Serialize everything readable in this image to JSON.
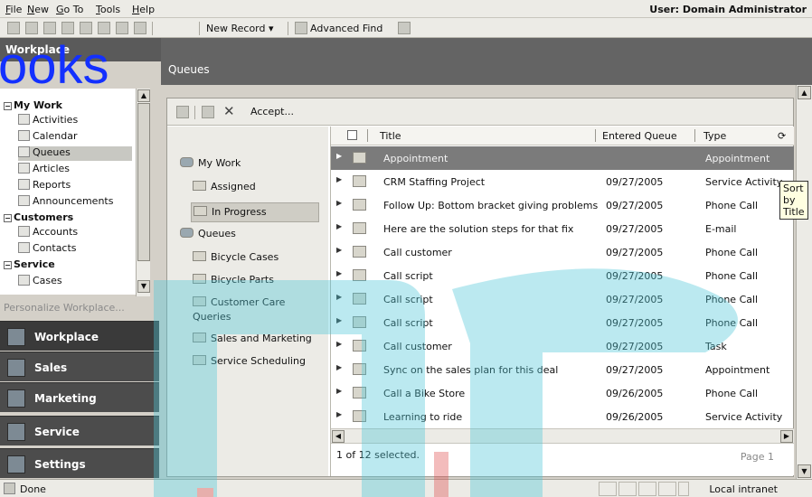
{
  "menu": [
    "File",
    "New",
    "Go To",
    "Tools",
    "Help"
  ],
  "user": "User: Domain Administrator",
  "toolbar": {
    "new_record": "New Record ▾",
    "advanced_find": "Advanced Find"
  },
  "nav": {
    "header": "Workplace",
    "overlay": "ooks",
    "groups": [
      {
        "title": "My Work",
        "items": [
          "Activities",
          "Calendar",
          "Queues",
          "Articles",
          "Reports",
          "Announcements"
        ]
      },
      {
        "title": "Customers",
        "items": [
          "Accounts",
          "Contacts"
        ]
      },
      {
        "title": "Service",
        "items": [
          "Cases"
        ]
      }
    ],
    "personalize": "Personalize Workplace...",
    "buttons": [
      "Workplace",
      "Sales",
      "Marketing",
      "Service",
      "Settings"
    ]
  },
  "main": {
    "title": "Queues"
  },
  "panel_toolbar": {
    "accept": "Accept..."
  },
  "queue_tree": {
    "my_work": "My Work",
    "my_work_items": [
      "Assigned",
      "In Progress"
    ],
    "queues": "Queues",
    "queue_items": [
      "Bicycle Cases",
      "Bicycle Parts",
      "Customer Care",
      "Queries",
      "Sales and Marketing",
      "Service Scheduling"
    ]
  },
  "grid": {
    "columns": [
      "Title",
      "Entered Queue",
      "Type"
    ],
    "tooltip": "Sort by Title",
    "rows": [
      {
        "title": "Appointment",
        "date": "",
        "type": "Appointment"
      },
      {
        "title": "CRM Staffing Project",
        "date": "09/27/2005",
        "type": "Service Activity"
      },
      {
        "title": "Follow Up: Bottom bracket giving problems",
        "date": "09/27/2005",
        "type": "Phone Call"
      },
      {
        "title": "Here are the solution steps for that fix",
        "date": "09/27/2005",
        "type": "E-mail"
      },
      {
        "title": "Call customer",
        "date": "09/27/2005",
        "type": "Phone Call"
      },
      {
        "title": "Call script",
        "date": "09/27/2005",
        "type": "Phone Call"
      },
      {
        "title": "Call script",
        "date": "09/27/2005",
        "type": "Phone Call"
      },
      {
        "title": "Call script",
        "date": "09/27/2005",
        "type": "Phone Call"
      },
      {
        "title": "Call customer",
        "date": "09/27/2005",
        "type": "Task"
      },
      {
        "title": "Sync on the sales plan for this deal",
        "date": "09/27/2005",
        "type": "Appointment"
      },
      {
        "title": "Call a Bike Store",
        "date": "09/26/2005",
        "type": "Phone Call"
      },
      {
        "title": "Learning to ride",
        "date": "09/26/2005",
        "type": "Service Activity"
      }
    ],
    "selected": "1 of 12 selected.",
    "page": "Page 1"
  },
  "status": {
    "left": "Done",
    "zone": "Local intranet"
  },
  "colors": {
    "header_dark": "#646464",
    "selected_row": "#7b7b7b",
    "watermark_cyan": "#4fc8d8",
    "watermark_red": "#e05050",
    "overlay_blue": "#1330ff"
  }
}
